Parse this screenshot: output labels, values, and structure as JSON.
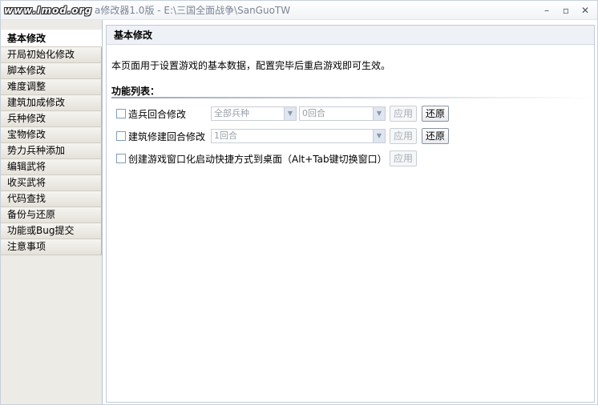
{
  "window": {
    "logo_text": "www.Imod.org",
    "title": "a修改器1.0版 - E:\\三国全面战争\\SanGuoTW",
    "controls": {
      "minimize": "–",
      "maximize": "▫",
      "close": "✕"
    }
  },
  "sidebar": {
    "items": [
      {
        "label": "基本修改",
        "active": true
      },
      {
        "label": "开局初始化修改"
      },
      {
        "label": "脚本修改"
      },
      {
        "label": "难度调整"
      },
      {
        "label": "建筑加成修改"
      },
      {
        "label": "兵种修改"
      },
      {
        "label": "宝物修改"
      },
      {
        "label": "势力兵种添加"
      },
      {
        "label": "编辑武将"
      },
      {
        "label": "收买武将"
      },
      {
        "label": "代码查找"
      },
      {
        "label": "备份与还原"
      },
      {
        "label": "功能或Bug提交"
      },
      {
        "label": "注意事项"
      }
    ]
  },
  "main": {
    "header": "基本修改",
    "description": "本页面用于设置游戏的基本数据，配置完毕后重启游戏即可生效。",
    "section_title": "功能列表：",
    "rows": [
      {
        "label": "造兵回合修改",
        "select1": "全部兵种",
        "select2": "0回合",
        "apply": "应用",
        "restore": "还原"
      },
      {
        "label": "建筑修建回合修改",
        "select1": "1回合",
        "apply": "应用",
        "restore": "还原"
      },
      {
        "label": "创建游戏窗口化启动快捷方式到桌面（Alt+Tab键切换窗口）",
        "apply": "应用"
      }
    ]
  }
}
